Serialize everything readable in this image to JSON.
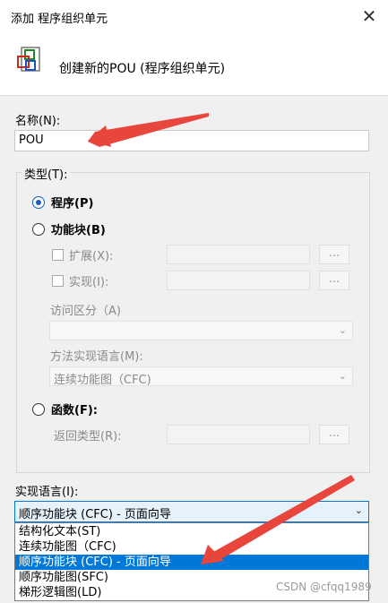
{
  "window": {
    "title": "添加 程序组织单元",
    "close_glyph": "✕"
  },
  "header": {
    "description": "创建新的POU (程序组织单元)"
  },
  "name": {
    "label": "名称(N):",
    "value": "POU"
  },
  "type_group": {
    "legend": "类型(T):",
    "program": {
      "label": "程序(P)",
      "checked": true
    },
    "function_block": {
      "label": "功能块(B)",
      "checked": false,
      "extends_label": "扩展(X):",
      "implements_label": "实现(I):",
      "access_label": "访问区分（A)",
      "method_lang_label": "方法实现语言(M):",
      "method_lang_value": "连续功能图（CFC)",
      "dots": "..."
    },
    "function": {
      "label": "函数(F):",
      "checked": false,
      "return_type_label": "返回类型(R):",
      "dots": "..."
    }
  },
  "impl_lang": {
    "label": "实现语言(I):",
    "selected": "顺序功能块 (CFC) - 页面向导",
    "options": [
      "结构化文本(ST)",
      "连续功能图（CFC)",
      "顺序功能块 (CFC) - 页面向导",
      "顺序功能图(SFC)",
      "梯形逻辑图(LD)"
    ],
    "highlighted_index": 2
  },
  "watermark": "CSDN @cfqq1989",
  "colors": {
    "accent": "#0078d7",
    "arrow": "#e8453c"
  }
}
